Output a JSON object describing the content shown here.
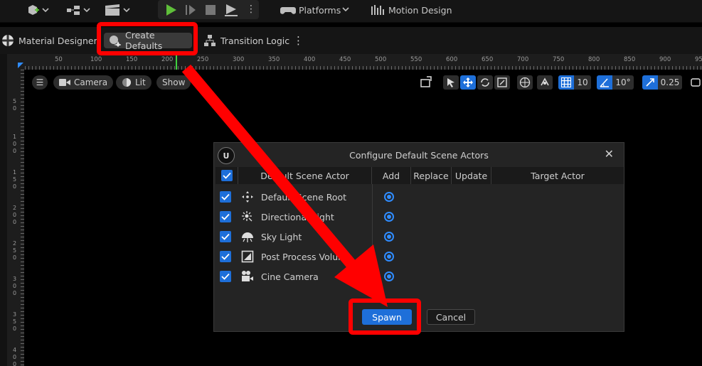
{
  "toolbar": {
    "platforms_label": "Platforms",
    "motion_design_label": "Motion Design"
  },
  "secondbar": {
    "material_designer_label": "Material Designer",
    "create_defaults_label": "Create Defaults",
    "transition_logic_label": "Transition Logic"
  },
  "ruler": {
    "h_labels": [
      "50",
      "100",
      "150",
      "200",
      "250",
      "300",
      "350",
      "400",
      "450",
      "500",
      "550",
      "600",
      "650",
      "700",
      "750",
      "800",
      "850",
      "900",
      "950"
    ],
    "v_labels": [
      "5 0",
      "1 0 0",
      "1 5 0",
      "2 0 0",
      "2 5 0",
      "3 0 0",
      "3 5 0",
      "4 0 0"
    ]
  },
  "viewport": {
    "camera_label": "Camera",
    "lit_label": "Lit",
    "show_label": "Show",
    "grid_snap_value": "10",
    "rotation_snap_value": "10°",
    "scale_snap_value": "0.25"
  },
  "dialog": {
    "title": "Configure Default Scene Actors",
    "columns": [
      "Default Scene Actor",
      "Add",
      "Replace",
      "Update",
      "Target Actor"
    ],
    "rows": [
      {
        "name": "Default Scene Root"
      },
      {
        "name": "Directional Light"
      },
      {
        "name": "Sky Light"
      },
      {
        "name": "Post Process Volume"
      },
      {
        "name": "Cine Camera"
      }
    ],
    "spawn_label": "Spawn",
    "cancel_label": "Cancel"
  },
  "colors": {
    "accent_blue": "#1e6fd9",
    "highlight_red": "#ff0000",
    "play_green": "#5fbf3a"
  }
}
